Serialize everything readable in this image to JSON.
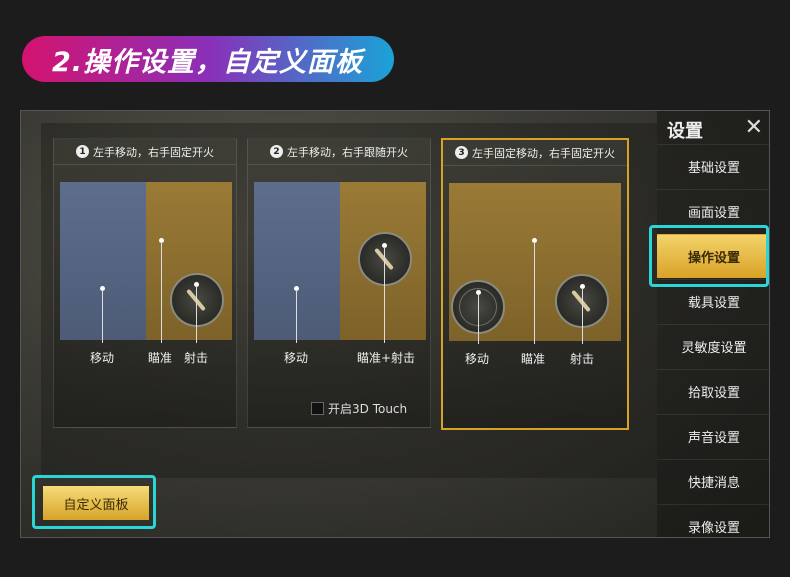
{
  "banner": {
    "title": "2.操作设置，自定义面板"
  },
  "sidebar": {
    "title": "设置",
    "close_icon": "close-icon",
    "items": [
      {
        "label": "基础设置"
      },
      {
        "label": "画面设置"
      },
      {
        "label": "操作设置"
      },
      {
        "label": "载具设置"
      },
      {
        "label": "灵敏度设置"
      },
      {
        "label": "拾取设置"
      },
      {
        "label": "声音设置"
      },
      {
        "label": "快捷消息"
      },
      {
        "label": "录像设置"
      }
    ],
    "active_index": 2
  },
  "modes": [
    {
      "num": "1",
      "title": "左手移动，右手固定开火",
      "labels": [
        "移动",
        "瞄准",
        "射击"
      ]
    },
    {
      "num": "2",
      "title": "左手移动，右手跟随开火",
      "labels": [
        "移动",
        "瞄准+射击"
      ]
    },
    {
      "num": "3",
      "title": "左手固定移动，右手固定开火",
      "labels": [
        "移动",
        "瞄准",
        "射击"
      ]
    }
  ],
  "touch_option": {
    "label": "开启3D Touch",
    "checked": false
  },
  "custom_button": {
    "label": "自定义面板"
  },
  "colors": {
    "highlight": "#2cd4d6",
    "accent_gold": "#d6a328"
  }
}
